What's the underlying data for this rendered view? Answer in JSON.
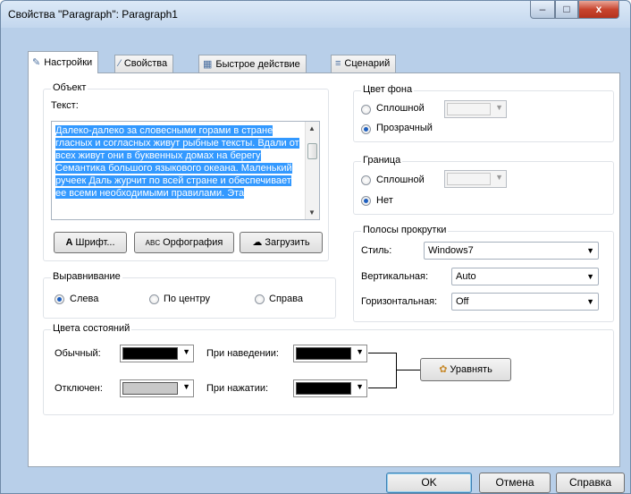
{
  "window": {
    "title": "Свойства \"Paragraph\": Paragraph1",
    "min_label": "–",
    "max_label": "□",
    "close_label": "x"
  },
  "tabs": [
    {
      "label": "Настройки",
      "icon": "pencil-icon",
      "active": true
    },
    {
      "label": "Свойства",
      "icon": "wand-icon",
      "active": false
    },
    {
      "label": "Быстрое действие",
      "icon": "action-icon",
      "active": false
    },
    {
      "label": "Сценарий",
      "icon": "script-icon",
      "active": false
    }
  ],
  "object_group": {
    "label": "Объект",
    "text_label": "Текст:",
    "text_value": "Далеко-далеко за словесными горами в стране гласных и согласных живут рыбные тексты. Вдали от всех живут они в буквенных домах на берегу Семантика большого языкового океана. Маленький ручеек Даль журчит по всей стране и обеспечивает ее всеми необходимыми правилами. Эта",
    "font_button": "Шрифт...",
    "spell_button": "Орфография",
    "load_button": "Загрузить"
  },
  "alignment_group": {
    "label": "Выравнивание",
    "options": [
      "Слева",
      "По центру",
      "Справа"
    ],
    "selected": "Слева"
  },
  "background_group": {
    "label": "Цвет фона",
    "solid_label": "Сплошной",
    "transparent_label": "Прозрачный",
    "selected": "Прозрачный"
  },
  "border_group": {
    "label": "Граница",
    "solid_label": "Сплошной",
    "none_label": "Нет",
    "selected": "Нет"
  },
  "scrollbars_group": {
    "label": "Полосы прокрутки",
    "style_label": "Стиль:",
    "style_value": "Windows7",
    "vertical_label": "Вертикальная:",
    "vertical_value": "Auto",
    "horizontal_label": "Горизонтальная:",
    "horizontal_value": "Off"
  },
  "state_colors_group": {
    "label": "Цвета состояний",
    "normal_label": "Обычный:",
    "normal_color": "#000000",
    "disabled_label": "Отключен:",
    "disabled_color": "#c8c8c8",
    "hover_label": "При наведении:",
    "hover_color": "#000000",
    "pressed_label": "При нажатии:",
    "pressed_color": "#000000",
    "equalize_button": "Уравнять"
  },
  "footer": {
    "ok": "OK",
    "cancel": "Отмена",
    "help": "Справка"
  }
}
